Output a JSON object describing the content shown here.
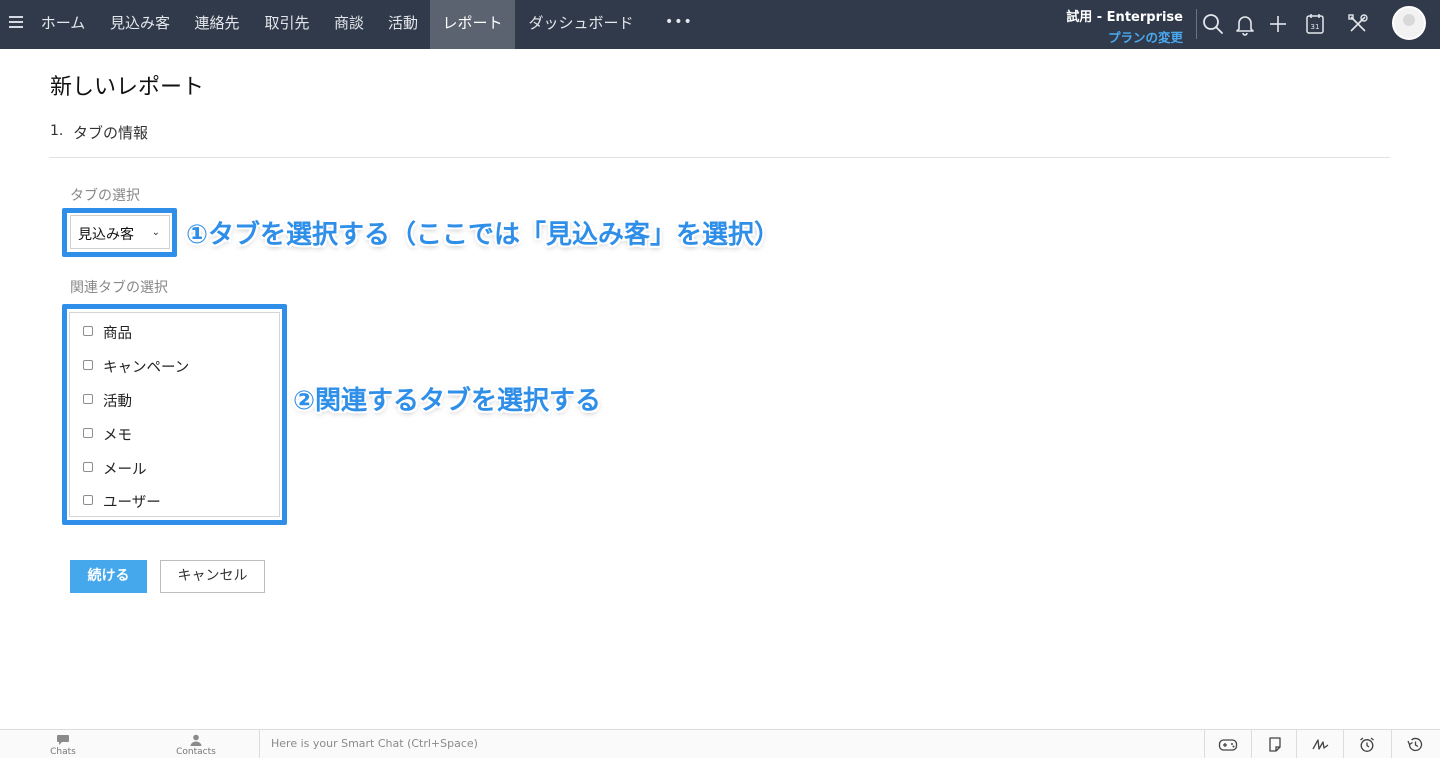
{
  "nav": {
    "tabs": [
      {
        "label": "ホーム",
        "active": false
      },
      {
        "label": "見込み客",
        "active": false
      },
      {
        "label": "連絡先",
        "active": false
      },
      {
        "label": "取引先",
        "active": false
      },
      {
        "label": "商談",
        "active": false
      },
      {
        "label": "活動",
        "active": false
      },
      {
        "label": "レポート",
        "active": true
      },
      {
        "label": "ダッシュボード",
        "active": false
      }
    ],
    "more_label": "•••",
    "trial_label": "試用 - Enterprise",
    "plan_link": "プランの変更",
    "icons": [
      "search-icon",
      "bell-icon",
      "plus-icon",
      "calendar-icon",
      "tools-icon"
    ],
    "calendar_day": "31"
  },
  "page": {
    "title": "新しいレポート",
    "step_number": "1.",
    "step_label": "タブの情報"
  },
  "form": {
    "tab_select_label": "タブの選択",
    "tab_select_value": "見込み客",
    "related_label": "関連タブの選択",
    "related_tabs": [
      "商品",
      "キャンペーン",
      "活動",
      "メモ",
      "メール",
      "ユーザー"
    ],
    "continue_label": "続ける",
    "cancel_label": "キャンセル"
  },
  "annotations": {
    "note1": "①タブを選択する（ここでは「見込み客」を選択）",
    "note2": "②関連するタブを選択する",
    "color": "#2f8fe8"
  },
  "bottombar": {
    "chats_label": "Chats",
    "contacts_label": "Contacts",
    "smartchat_placeholder": "Here is your Smart Chat (Ctrl+Space)",
    "icons": [
      "gamepad-icon",
      "sticky-note-icon",
      "signature-icon",
      "alarm-clock-icon",
      "history-icon"
    ]
  },
  "colors": {
    "nav_bg": "#313a4a",
    "nav_active": "#5b6270",
    "accent_link": "#4aa9f0",
    "primary_button": "#45a7ec"
  }
}
